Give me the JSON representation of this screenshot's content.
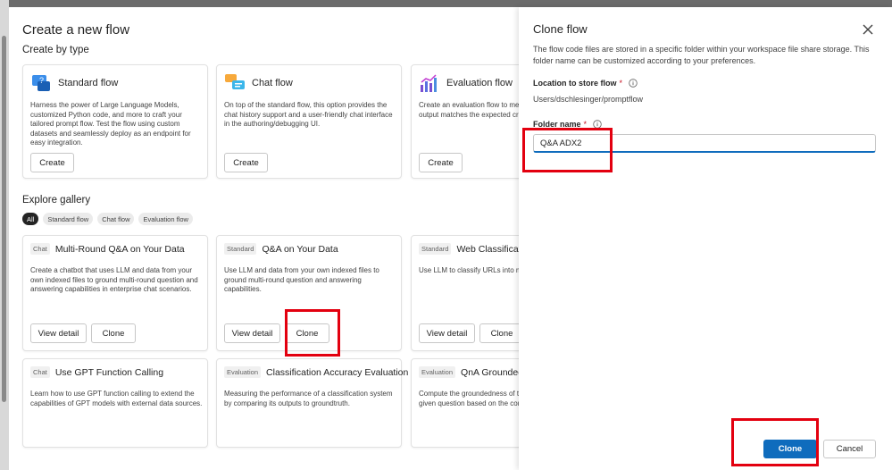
{
  "main": {
    "title": "Create a new flow",
    "create_by_type_title": "Create by type",
    "type_cards": [
      {
        "title": "Standard flow",
        "icon": "standard-flow-icon",
        "description": "Harness the power of Large Language Models, customized Python code, and more to craft your tailored prompt flow. Test the flow using custom datasets and seamlessly deploy as an endpoint for easy integration.",
        "button": "Create"
      },
      {
        "title": "Chat flow",
        "icon": "chat-flow-icon",
        "description": "On top of the standard flow, this option provides the chat history support and a user-friendly chat interface in the authoring/debugging UI.",
        "button": "Create"
      },
      {
        "title": "Evaluation flow",
        "icon": "evaluation-flow-icon",
        "description": "Create an evaluation flow to measure how well the output matches the expected criteria.",
        "button": "Create"
      }
    ],
    "gallery_title": "Explore gallery",
    "chips": [
      "All",
      "Standard flow",
      "Chat flow",
      "Evaluation flow"
    ],
    "gallery": [
      {
        "tag": "Chat",
        "name": "Multi-Round Q&A on Your Data",
        "description": "Create a chatbot that uses LLM and data from your own indexed files to ground multi-round question and answering capabilities in enterprise chat scenarios.",
        "detail": "View detail",
        "clone": "Clone"
      },
      {
        "tag": "Standard",
        "name": "Q&A on Your Data",
        "description": "Use LLM and data from your own indexed files to ground multi-round question and answering capabilities.",
        "detail": "View detail",
        "clone": "Clone"
      },
      {
        "tag": "Standard",
        "name": "Web Classification",
        "description": "Use LLM to classify URLs into multiple categories.",
        "detail": "View detail",
        "clone": "Clone"
      },
      {
        "tag": "Chat",
        "name": "Use GPT Function Calling",
        "description": "Learn how to use GPT function calling to extend the capabilities of GPT models with external data sources."
      },
      {
        "tag": "Evaluation",
        "name": "Classification Accuracy Evaluation",
        "description": "Measuring the performance of a classification system by comparing its outputs to groundtruth."
      },
      {
        "tag": "Evaluation",
        "name": "QnA Groundedness",
        "description": "Compute the groundedness of the answer for the given question based on the context."
      }
    ]
  },
  "clone_panel": {
    "title": "Clone flow",
    "description": "The flow code files are stored in a specific folder within your workspace file share storage. This folder name can be customized according to your preferences.",
    "location_label": "Location to store flow",
    "location_value": "Users/dschlesinger/promptflow",
    "folder_label": "Folder name",
    "folder_value": "Q&A ADX2",
    "clone_button": "Clone",
    "cancel_button": "Cancel"
  },
  "colors": {
    "primary": "#0f6cbd",
    "highlight": "#e3000f"
  }
}
